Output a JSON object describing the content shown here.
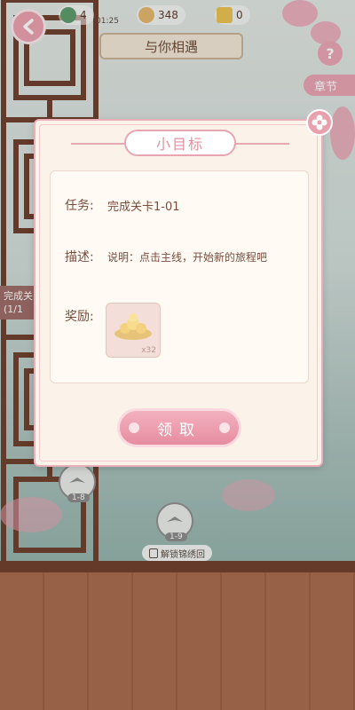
{
  "hud": {
    "energy": "4",
    "energy_timer": "01:25",
    "coins": "348",
    "items": "0",
    "scene_title": "与你相遇",
    "help": "?",
    "chapter_tab": "章节",
    "side_task_line1": "完成关",
    "side_task_line2": "(1/1",
    "unlock_hint": "解锁锦绣回"
  },
  "levels": [
    {
      "label": "1-8"
    },
    {
      "label": "1-9"
    }
  ],
  "dialog": {
    "title": "小目标",
    "task_label": "任务:",
    "task_value": "完成关卡1-01",
    "desc_label": "描述:",
    "desc_value": "说明：点击主线，开始新的旅程吧",
    "reward_label": "奖励:",
    "reward_qty": "x32",
    "claim_button": "领取"
  },
  "colors": {
    "accent_pink": "#e9a0ad",
    "dialog_bg": "#fbf2ea",
    "text_brown": "#7a4d3d"
  }
}
